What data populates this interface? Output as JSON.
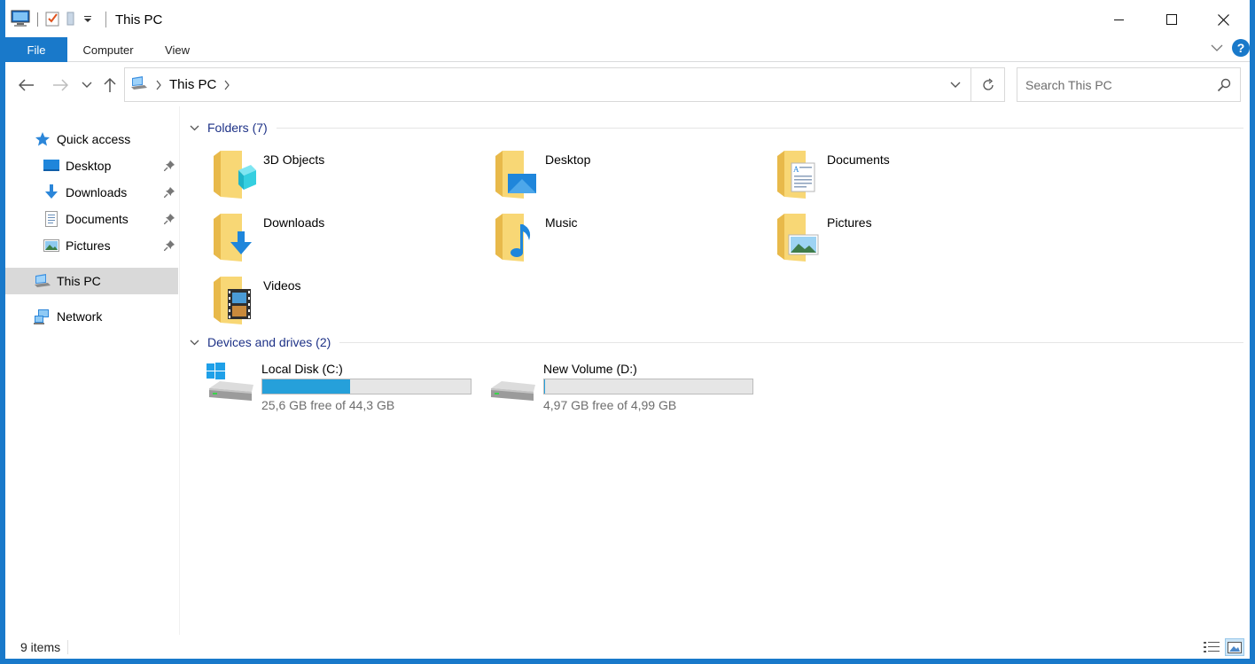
{
  "window": {
    "title": "This PC",
    "quick_access_toolbar": [
      "this-pc-icon",
      "properties-icon",
      "new-folder-icon",
      "customize-dropdown-icon"
    ],
    "controls": [
      "minimize-icon",
      "maximize-icon",
      "close-icon"
    ],
    "accent": "#1979ca"
  },
  "ribbon": {
    "tabs": [
      {
        "label": "File",
        "active": true
      },
      {
        "label": "Computer",
        "active": false
      },
      {
        "label": "View",
        "active": false
      }
    ]
  },
  "address": {
    "crumbs": [
      "This PC"
    ],
    "search_placeholder": "Search This PC"
  },
  "sidebar": {
    "quick_access": "Quick access",
    "pinned": [
      {
        "label": "Desktop",
        "icon": "desktop-icon"
      },
      {
        "label": "Downloads",
        "icon": "downloads-icon"
      },
      {
        "label": "Documents",
        "icon": "documents-icon"
      },
      {
        "label": "Pictures",
        "icon": "pictures-icon"
      }
    ],
    "this_pc": "This PC",
    "network": "Network"
  },
  "folders": {
    "header": "Folders (7)",
    "items": [
      {
        "label": "3D Objects",
        "icon": "3d-objects-folder-icon"
      },
      {
        "label": "Desktop",
        "icon": "desktop-folder-icon"
      },
      {
        "label": "Documents",
        "icon": "documents-folder-icon"
      },
      {
        "label": "Downloads",
        "icon": "downloads-folder-icon"
      },
      {
        "label": "Music",
        "icon": "music-folder-icon"
      },
      {
        "label": "Pictures",
        "icon": "pictures-folder-icon"
      },
      {
        "label": "Videos",
        "icon": "videos-folder-icon"
      }
    ]
  },
  "drives": {
    "header": "Devices and drives (2)",
    "items": [
      {
        "label": "Local Disk (C:)",
        "free": "25,6 GB free of 44,3 GB",
        "used_fraction": 0.42,
        "icon": "windows-drive-icon"
      },
      {
        "label": "New Volume (D:)",
        "free": "4,97 GB free of 4,99 GB",
        "used_fraction": 0.004,
        "icon": "drive-icon"
      }
    ]
  },
  "status": {
    "count": "9 items",
    "views": [
      "details-view-icon",
      "large-icons-view-icon"
    ]
  }
}
